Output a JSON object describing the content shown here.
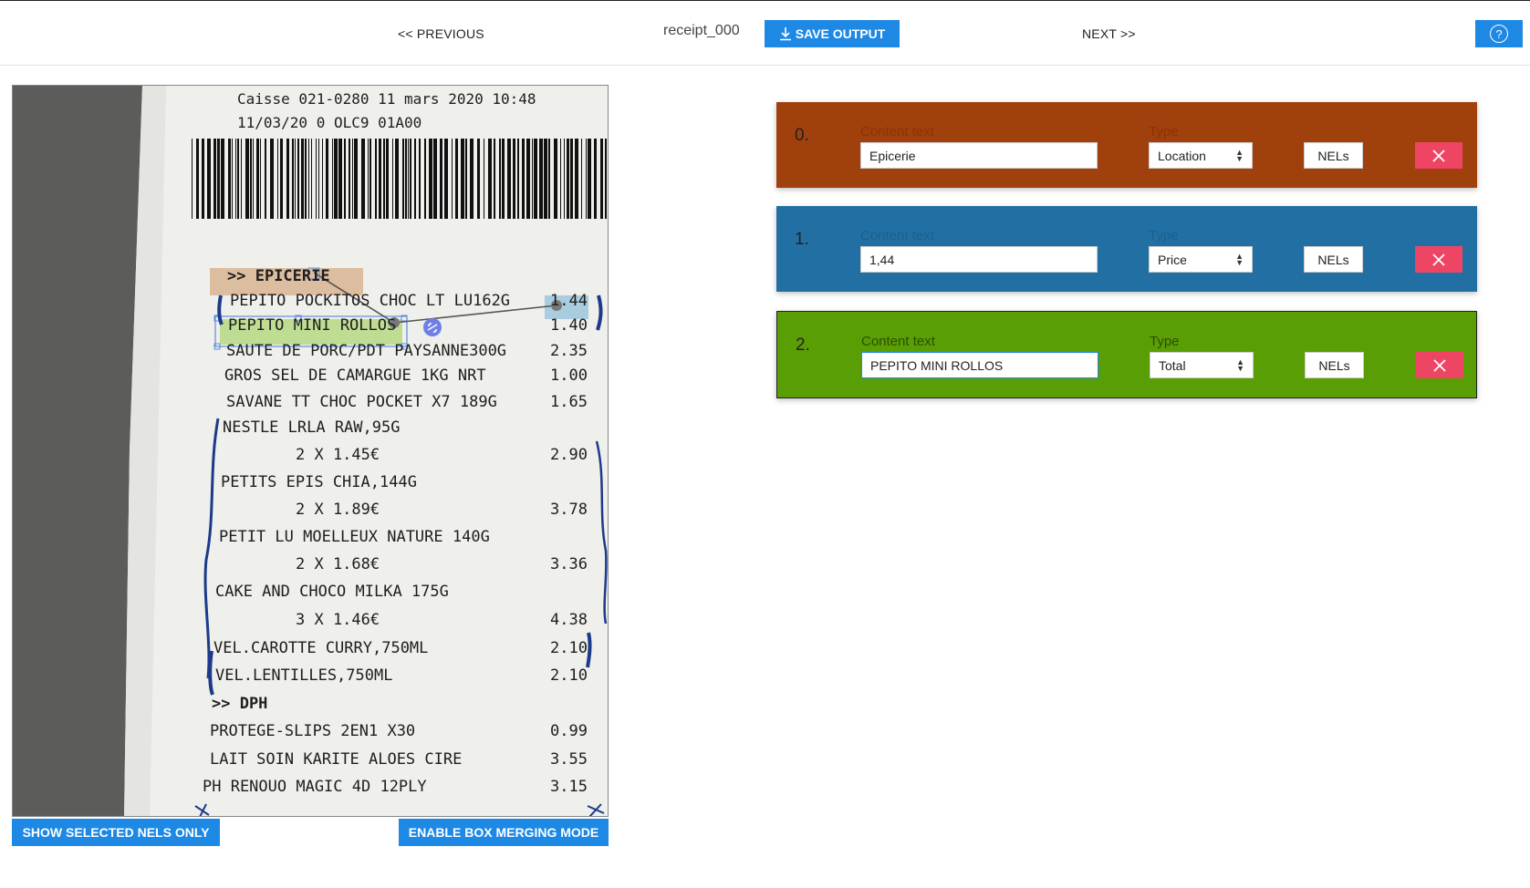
{
  "toolbar": {
    "previous_label": "<< PREVIOUS",
    "file_name": "receipt_000",
    "save_label": "SAVE OUTPUT",
    "next_label": "NEXT >>",
    "help_glyph": "?"
  },
  "image_panel": {
    "show_nels_label": "SHOW SELECTED NELS ONLY",
    "merge_mode_label": "ENABLE BOX MERGING MODE",
    "receipt_lines": [
      {
        "text": "Caisse 021-0280 11 mars 2020 10:48",
        "price": ""
      },
      {
        "text": "11/03/20 0 OLC9 01A00",
        "price": ""
      },
      {
        "text": ">> EPICERIE",
        "price": ""
      },
      {
        "text": "PEPITO POCKITOS CHOC LT LU162G",
        "price": "1.44"
      },
      {
        "text": "PEPITO MINI ROLLOS",
        "price": "1.40"
      },
      {
        "text": "SAUTE DE PORC/PDT PAYSANNE300G",
        "price": "2.35"
      },
      {
        "text": "GROS SEL DE CAMARGUE 1KG NRT",
        "price": "1.00"
      },
      {
        "text": "SAVANE TT CHOC POCKET X7 189G",
        "price": "1.65"
      },
      {
        "text": "NESTLE LRLA RAW,95G",
        "price": ""
      },
      {
        "text": "2 X 1.45€",
        "price": "2.90"
      },
      {
        "text": "PETITS EPIS CHIA,144G",
        "price": ""
      },
      {
        "text": "2 X 1.89€",
        "price": "3.78"
      },
      {
        "text": "PETIT LU MOELLEUX NATURE 140G",
        "price": ""
      },
      {
        "text": "2 X 1.68€",
        "price": "3.36"
      },
      {
        "text": "CAKE AND CHOCO MILKA 175G",
        "price": ""
      },
      {
        "text": "3 X 1.46€",
        "price": "4.38"
      },
      {
        "text": "VEL.CAROTTE CURRY,750ML",
        "price": "2.10"
      },
      {
        "text": "VEL.LENTILLES,750ML",
        "price": "2.10"
      },
      {
        "text": ">> DPH",
        "price": ""
      },
      {
        "text": "PROTEGE-SLIPS 2EN1 X30",
        "price": "0.99"
      },
      {
        "text": "LAIT SOIN KARITE ALOES CIRE",
        "price": "3.55"
      },
      {
        "text": "PH RENOUO MAGIC 4D 12PLY",
        "price": "3.15"
      }
    ]
  },
  "entities": [
    {
      "index": "0.",
      "content_label": "Content text",
      "content_value": "Epicerie",
      "type_label": "Type",
      "type_value": "Location",
      "nels_label": "NELs",
      "color": "#a0400d"
    },
    {
      "index": "1.",
      "content_label": "Content text",
      "content_value": "1,44",
      "type_label": "Type",
      "type_value": "Price",
      "nels_label": "NELs",
      "color": "#2270a3"
    },
    {
      "index": "2.",
      "content_label": "Content text",
      "content_value": "PEPITO MINI ROLLOS",
      "type_label": "Type",
      "type_value": "Total",
      "nels_label": "NELs",
      "color": "#5a9e05"
    }
  ],
  "colors": {
    "accent": "#1e88e5",
    "delete": "#ef4565"
  }
}
